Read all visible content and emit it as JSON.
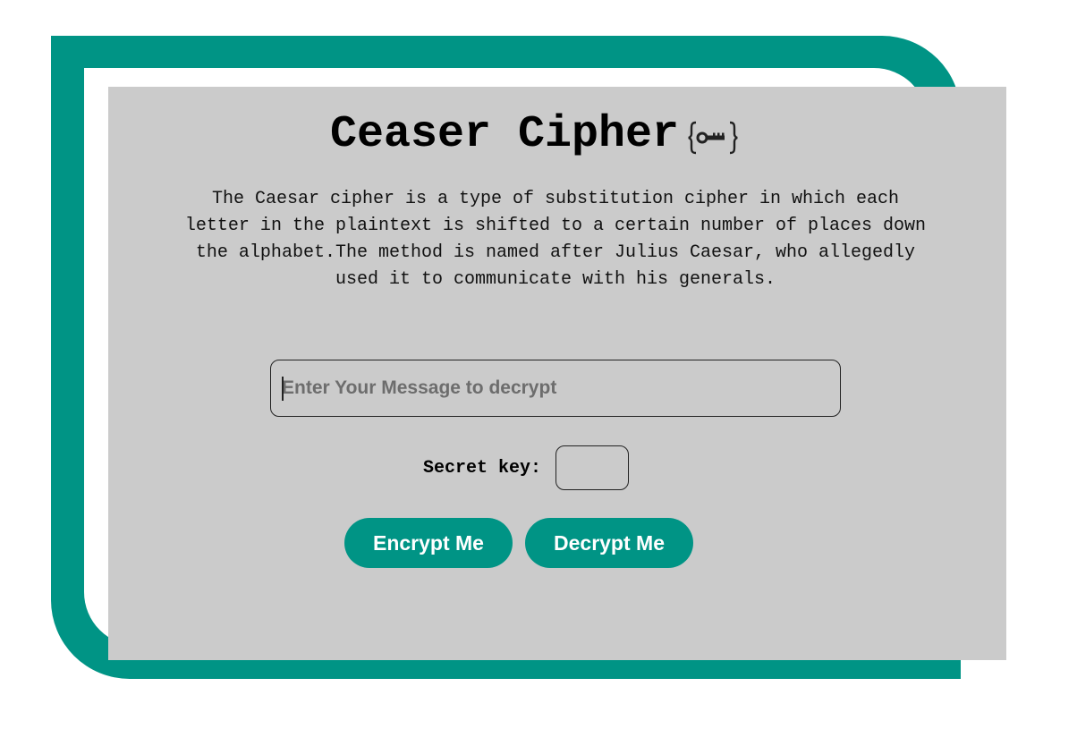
{
  "header": {
    "title": "Ceaser Cipher",
    "icon": "key-icon"
  },
  "description": "The Caesar cipher is a type of substitution cipher in which each letter in the plaintext is shifted to a certain number of places down the alphabet.The method is named after Julius Caesar, who allegedly used it to communicate with his generals.",
  "message_input": {
    "value": "",
    "placeholder": "Enter Your Message to decrypt"
  },
  "secret_key": {
    "label": "Secret key:",
    "value": ""
  },
  "buttons": {
    "encrypt_label": "Encrypt Me",
    "decrypt_label": "Decrypt Me"
  },
  "colors": {
    "accent": "#009485",
    "card_background": "#cbcbcb",
    "page_background": "#ffffff"
  }
}
